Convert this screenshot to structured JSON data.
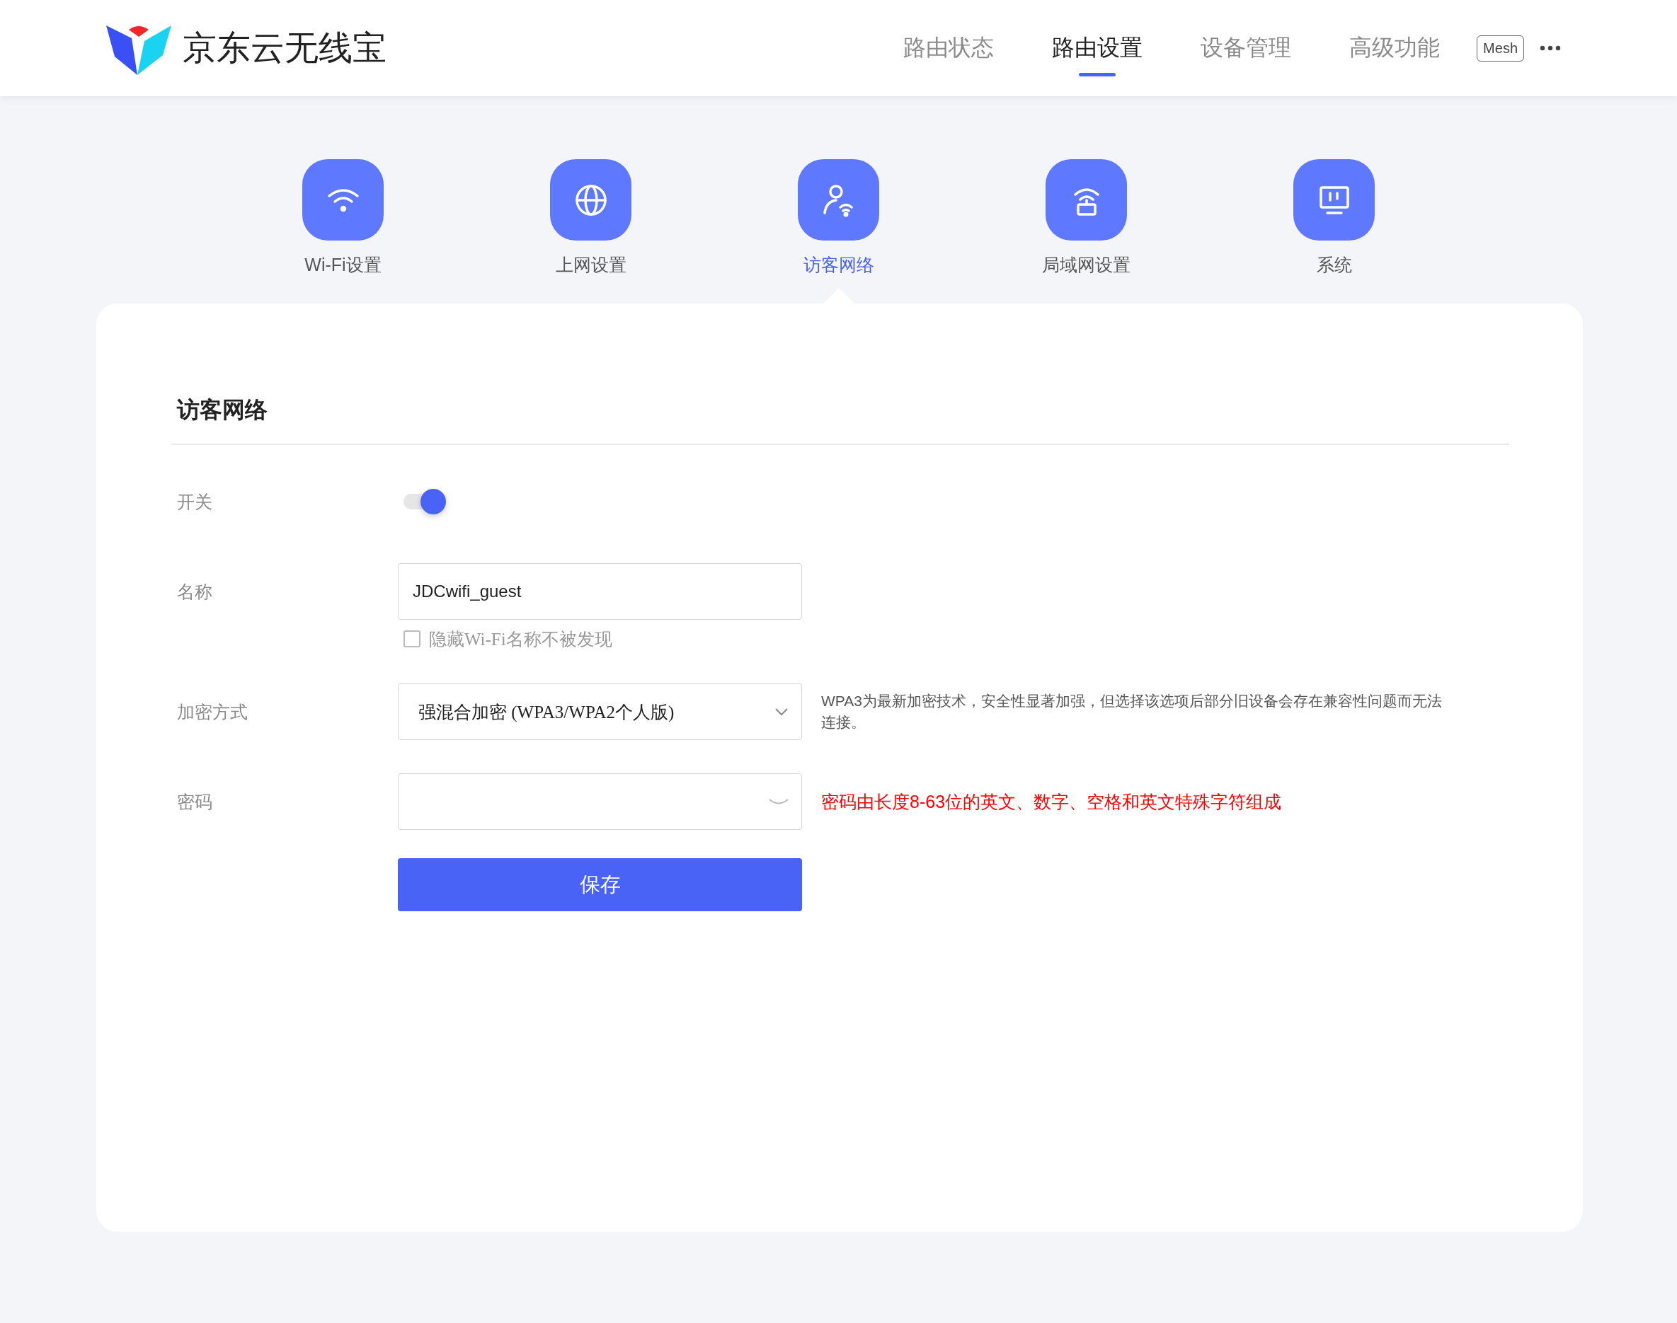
{
  "brand": {
    "name": "京东云无线宝"
  },
  "nav": [
    {
      "label": "路由状态",
      "selected": false
    },
    {
      "label": "路由设置",
      "selected": true
    },
    {
      "label": "设备管理",
      "selected": false
    },
    {
      "label": "高级功能",
      "selected": false
    }
  ],
  "mesh_badge": "Mesh",
  "sections": [
    {
      "kind": "wifi",
      "label": "Wi-Fi设置",
      "selected": false
    },
    {
      "kind": "internet",
      "label": "上网设置",
      "selected": false
    },
    {
      "kind": "guest",
      "label": "访客网络",
      "selected": true
    },
    {
      "kind": "lan",
      "label": "局域网设置",
      "selected": false
    },
    {
      "kind": "system",
      "label": "系统",
      "selected": false
    }
  ],
  "form": {
    "title": "访客网络",
    "fields": [
      {
        "kind": "toggle",
        "label": "开关",
        "on": true
      },
      {
        "kind": "text",
        "label": "名称",
        "value": "JDCwifi_guest",
        "checkbox": {
          "label": "隐藏Wi-Fi名称不被发现",
          "checked": false
        }
      },
      {
        "kind": "select",
        "label": "加密方式",
        "value": "强混合加密 (WPA3/WPA2个人版)",
        "hint": "WPA3为最新加密技术，安全性显著加强，但选择该选项后部分旧设备会存在兼容性问题而无法连接。"
      },
      {
        "kind": "password",
        "label": "密码",
        "error": "密码由长度8-63位的英文、数字、空格和英文特殊字符组成"
      }
    ],
    "save_button": "保存"
  }
}
